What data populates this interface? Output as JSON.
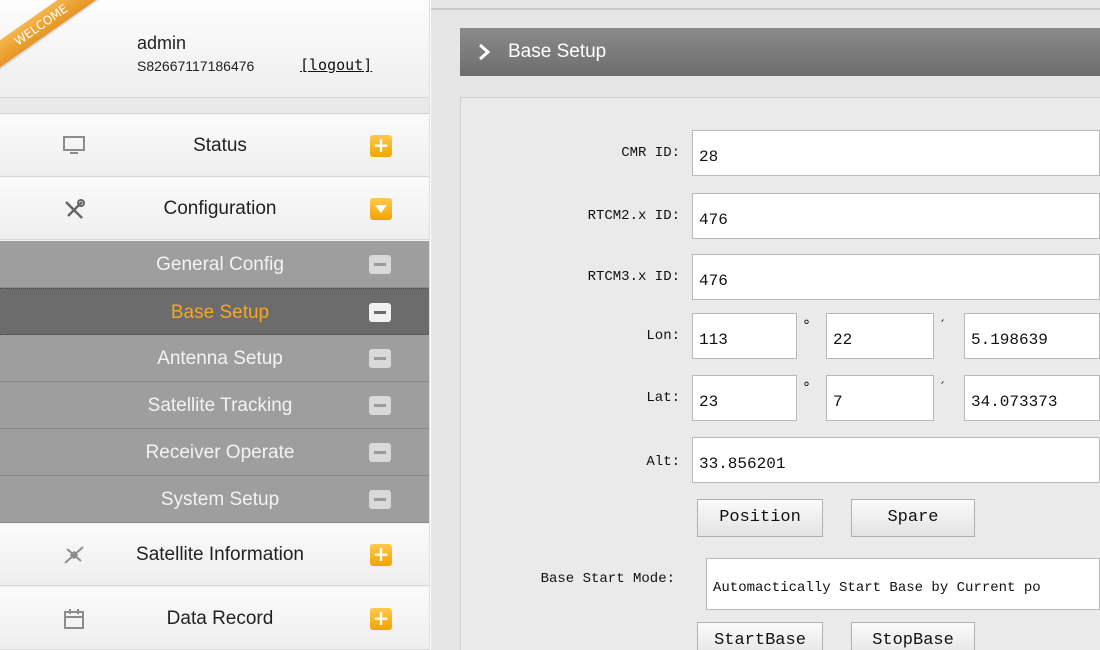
{
  "user": {
    "ribbon": "WELCOME",
    "name": "admin",
    "serial": "S82667117186476",
    "logout_label": "[logout]"
  },
  "menu": {
    "status": "Status",
    "configuration": "Configuration",
    "submenu": [
      "General Config",
      "Base Setup",
      "Antenna Setup",
      "Satellite Tracking",
      "Receiver Operate",
      "System Setup"
    ],
    "active_submenu": "Base Setup",
    "satellite_information": "Satellite Information",
    "data_record": "Data Record",
    "plus_symbol": "+"
  },
  "page": {
    "title": "Base Setup"
  },
  "form": {
    "cmr_label": "CMR ID:",
    "cmr_value": "28",
    "rtcm2_label": "RTCM2.x ID:",
    "rtcm2_value": "476",
    "rtcm3_label": "RTCM3.x ID:",
    "rtcm3_value": "476",
    "lon_label": "Lon:",
    "lon_deg": "113",
    "lon_min": "22",
    "lon_sec": "5.198639",
    "lat_label": "Lat:",
    "lat_deg": "23",
    "lat_min": "7",
    "lat_sec": "34.073373",
    "deg_symbol": "°",
    "min_symbol": "′",
    "alt_label": "Alt:",
    "alt_value": "33.856201",
    "position_button": "Position",
    "spare_button": "Spare",
    "start_mode_label": "Base Start Mode:",
    "start_mode_value": "Automactically Start Base by Current po",
    "startbase_button": "StartBase",
    "stopbase_button": "StopBase"
  },
  "colors": {
    "accent_orange": "#f0a500",
    "active_text": "#f6a623",
    "submenu_bg": "#9e9e9e",
    "title_bar": "#7a7a7a"
  },
  "icons": {
    "status": "monitor-icon",
    "configuration": "tools-icon",
    "satellite": "satellite-icon",
    "data_record": "calendar-icon",
    "title": "chevron-right-icon"
  }
}
